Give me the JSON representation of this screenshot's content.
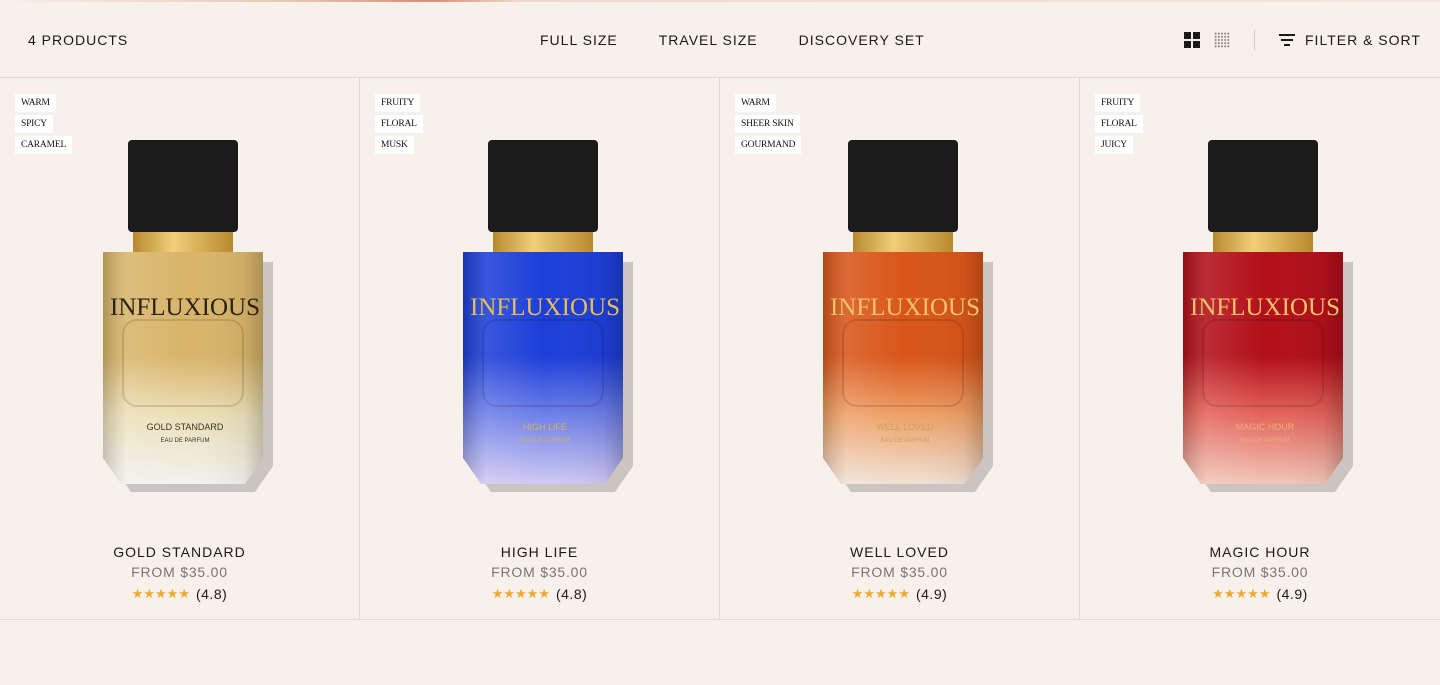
{
  "toolbar": {
    "product_count": "4 PRODUCTS",
    "tabs": [
      "FULL SIZE",
      "TRAVEL SIZE",
      "DISCOVERY SET"
    ],
    "filter_label": "FILTER & SORT"
  },
  "products": [
    {
      "name": "GOLD STANDARD",
      "price": "FROM $35.00",
      "rating_text": "(4.8)",
      "stars": "★★★★★",
      "tags": [
        "WARM",
        "SPICY",
        "CARAMEL"
      ],
      "bottle_brand": "INFLUXIOUS",
      "bottle_label": "GOLD STANDARD",
      "bottle_sub": "EAU DE PARFUM",
      "colors": {
        "top": "#d8b56a",
        "mid": "#ece0b8",
        "bottom": "#f2f2f0",
        "text": "#2a2418",
        "label": "#3a3426"
      }
    },
    {
      "name": "HIGH LIFE",
      "price": "FROM $35.00",
      "rating_text": "(4.8)",
      "stars": "★★★★★",
      "tags": [
        "FRUITY",
        "FLORAL",
        "MUSK"
      ],
      "bottle_brand": "INFLUXIOUS",
      "bottle_label": "HIGH LIFE",
      "bottle_sub": "EAU DE PARFUM",
      "colors": {
        "top": "#1d3fd8",
        "mid": "#6e7fe8",
        "bottom": "#cfcaf2",
        "text": "#e5bf55",
        "label": "#d5b25a"
      }
    },
    {
      "name": "WELL LOVED",
      "price": "FROM $35.00",
      "rating_text": "(4.9)",
      "stars": "★★★★★",
      "tags": [
        "WARM",
        "SHEER SKIN",
        "GOURMAND"
      ],
      "bottle_brand": "INFLUXIOUS",
      "bottle_label": "WELL LOVED",
      "bottle_sub": "EAU DE PARFUM",
      "colors": {
        "top": "#d9561a",
        "mid": "#eea066",
        "bottom": "#f0e2d6",
        "text": "#f0c36a",
        "label": "#c9a45a"
      }
    },
    {
      "name": "MAGIC HOUR",
      "price": "FROM $35.00",
      "rating_text": "(4.9)",
      "stars": "★★★★★",
      "tags": [
        "FRUITY",
        "FLORAL",
        "JUICY"
      ],
      "bottle_brand": "INFLUXIOUS",
      "bottle_label": "MAGIC HOUR",
      "bottle_sub": "EAU DE PARFUM",
      "colors": {
        "top": "#b3101a",
        "mid": "#e4645a",
        "bottom": "#f1c7b8",
        "text": "#f0c36a",
        "label": "#e8b07a"
      }
    }
  ]
}
